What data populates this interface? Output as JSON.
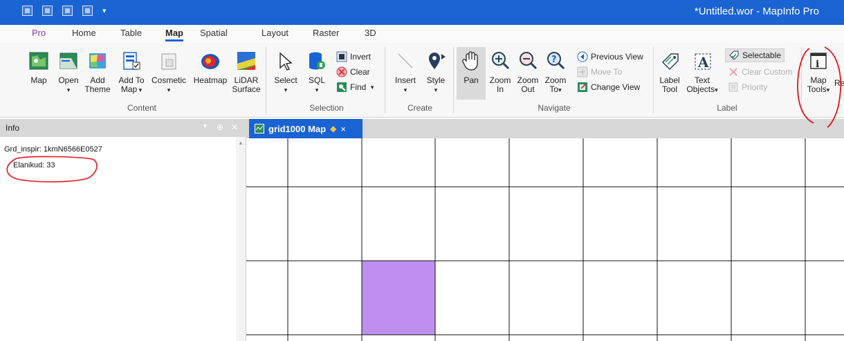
{
  "window": {
    "title": "*Untitled.wor - MapInfo Pro"
  },
  "menu_tabs": [
    {
      "label": "Pro"
    },
    {
      "label": "Home"
    },
    {
      "label": "Table"
    },
    {
      "label": "Map"
    },
    {
      "label": "Spatial"
    },
    {
      "label": "Layout"
    },
    {
      "label": "Raster"
    },
    {
      "label": "3D"
    }
  ],
  "active_tab": "Map",
  "ribbon": {
    "content": {
      "label": "Content",
      "map": "Map",
      "open": "Open",
      "add_theme_1": "Add",
      "add_theme_2": "Theme",
      "add_to_map_1": "Add To",
      "add_to_map_2": "Map",
      "cosmetic": "Cosmetic",
      "heatmap": "Heatmap",
      "lidar_1": "LiDAR",
      "lidar_2": "Surface"
    },
    "selection": {
      "label": "Selection",
      "select": "Select",
      "sql": "SQL",
      "invert": "Invert",
      "clear": "Clear",
      "find": "Find"
    },
    "create": {
      "label": "Create",
      "insert": "Insert",
      "style": "Style"
    },
    "navigate": {
      "label": "Navigate",
      "pan": "Pan",
      "zoom_in_1": "Zoom",
      "zoom_in_2": "In",
      "zoom_out_1": "Zoom",
      "zoom_out_2": "Out",
      "zoom_to_1": "Zoom",
      "zoom_to_2": "To",
      "previous_view": "Previous View",
      "move_to": "Move To",
      "change_view": "Change View"
    },
    "label_group": {
      "label": "Label",
      "label_tool_1": "Label",
      "label_tool_2": "Tool",
      "text_objects_1": "Text",
      "text_objects_2": "Objects",
      "selectable": "Selectable",
      "clear_custom": "Clear Custom",
      "priority": "Priority"
    },
    "tools": {
      "map_tools_1": "Map",
      "map_tools_2": "Tools",
      "cut_label": "Re"
    }
  },
  "info_panel": {
    "title": "Info",
    "fields": [
      {
        "text": "Grd_inspir:  1kmN6566E0527"
      },
      {
        "text": "Elanikud:  33"
      }
    ]
  },
  "map_window": {
    "tab_label": "grid1000 Map",
    "close": "×",
    "highlight_color": "#bf8ff0"
  },
  "colors": {
    "accent": "#1a63d3",
    "annotation": "#e0161b"
  }
}
